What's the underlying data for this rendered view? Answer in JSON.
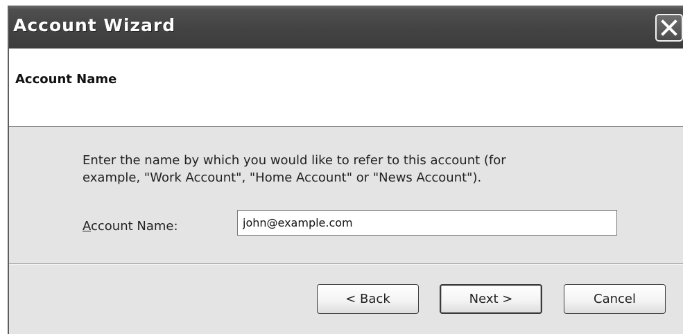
{
  "window": {
    "title": "Account Wizard",
    "close_icon": "close-x-icon"
  },
  "header": {
    "title": "Account Name"
  },
  "body": {
    "instruction_line1": "Enter the name by which you would like to refer to this account (for",
    "instruction_line2": "example, \"Work Account\", \"Home Account\" or \"News Account\").",
    "field_label_mnemonic": "A",
    "field_label_rest": "ccount Name:",
    "account_name_value": "john@example.com"
  },
  "buttons": {
    "back": "< Back",
    "next": "Next >",
    "cancel": "Cancel"
  }
}
